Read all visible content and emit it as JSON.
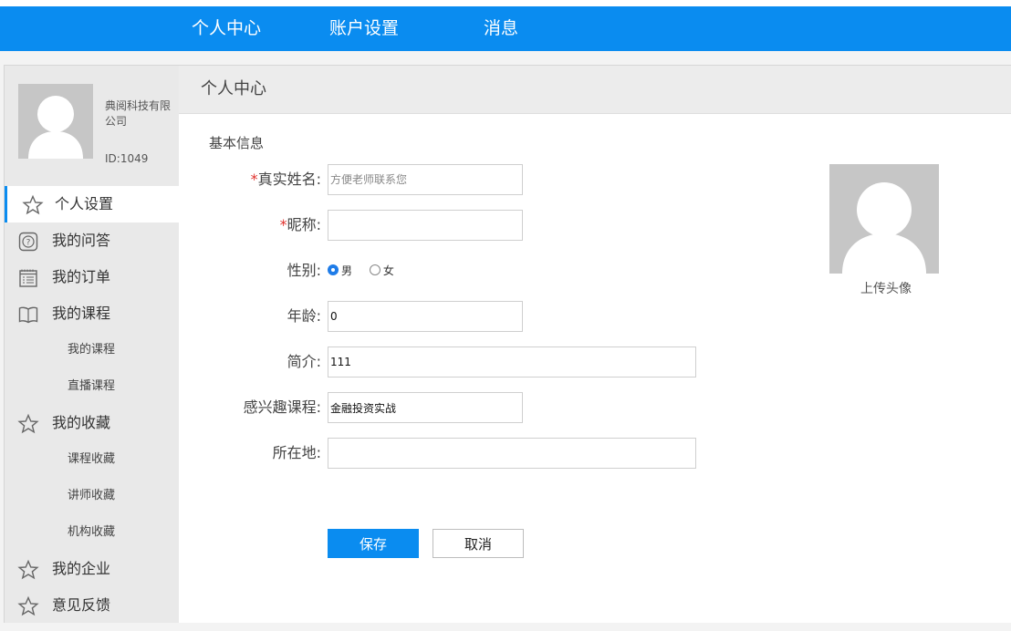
{
  "topnav": {
    "items": [
      {
        "label": "个人中心"
      },
      {
        "label": "账户设置"
      },
      {
        "label": "消息"
      }
    ]
  },
  "sidebar": {
    "company": "典阅科技有限公司",
    "user_id": "ID:1049",
    "menu": [
      {
        "label": "个人设置",
        "icon": "star-icon",
        "active": true
      },
      {
        "label": "我的问答",
        "icon": "question-icon"
      },
      {
        "label": "我的订单",
        "icon": "order-list-icon"
      },
      {
        "label": "我的课程",
        "icon": "book-icon"
      }
    ],
    "courses_sub": [
      "我的课程",
      "直播课程"
    ],
    "favorites": {
      "label": "我的收藏",
      "icon": "star-icon"
    },
    "favorites_sub": [
      "课程收藏",
      "讲师收藏",
      "机构收藏"
    ],
    "enterprise": {
      "label": "我的企业",
      "icon": "star-icon"
    },
    "feedback": {
      "label": "意见反馈",
      "icon": "star-icon"
    }
  },
  "main": {
    "title": "个人中心",
    "section_title": "基本信息",
    "form": {
      "real_name_label": "真实姓名:",
      "real_name_placeholder": "方便老师联系您",
      "real_name_value": "",
      "nickname_label": "昵称:",
      "nickname_value": "",
      "gender_label": "性别:",
      "gender_options": [
        "男",
        "女"
      ],
      "gender_selected": "男",
      "age_label": "年龄:",
      "age_value": "0",
      "intro_label": "简介:",
      "intro_value": "111",
      "interest_label": "感兴趣课程:",
      "interest_value": "金融投资实战",
      "location_label": "所在地:",
      "location_value": ""
    },
    "buttons": {
      "save": "保存",
      "cancel": "取消"
    },
    "avatar": {
      "upload_label": "上传头像"
    }
  },
  "colors": {
    "primary": "#0a8cf0",
    "required": "#e0302c",
    "avatar_bg": "#c6c6c6"
  }
}
